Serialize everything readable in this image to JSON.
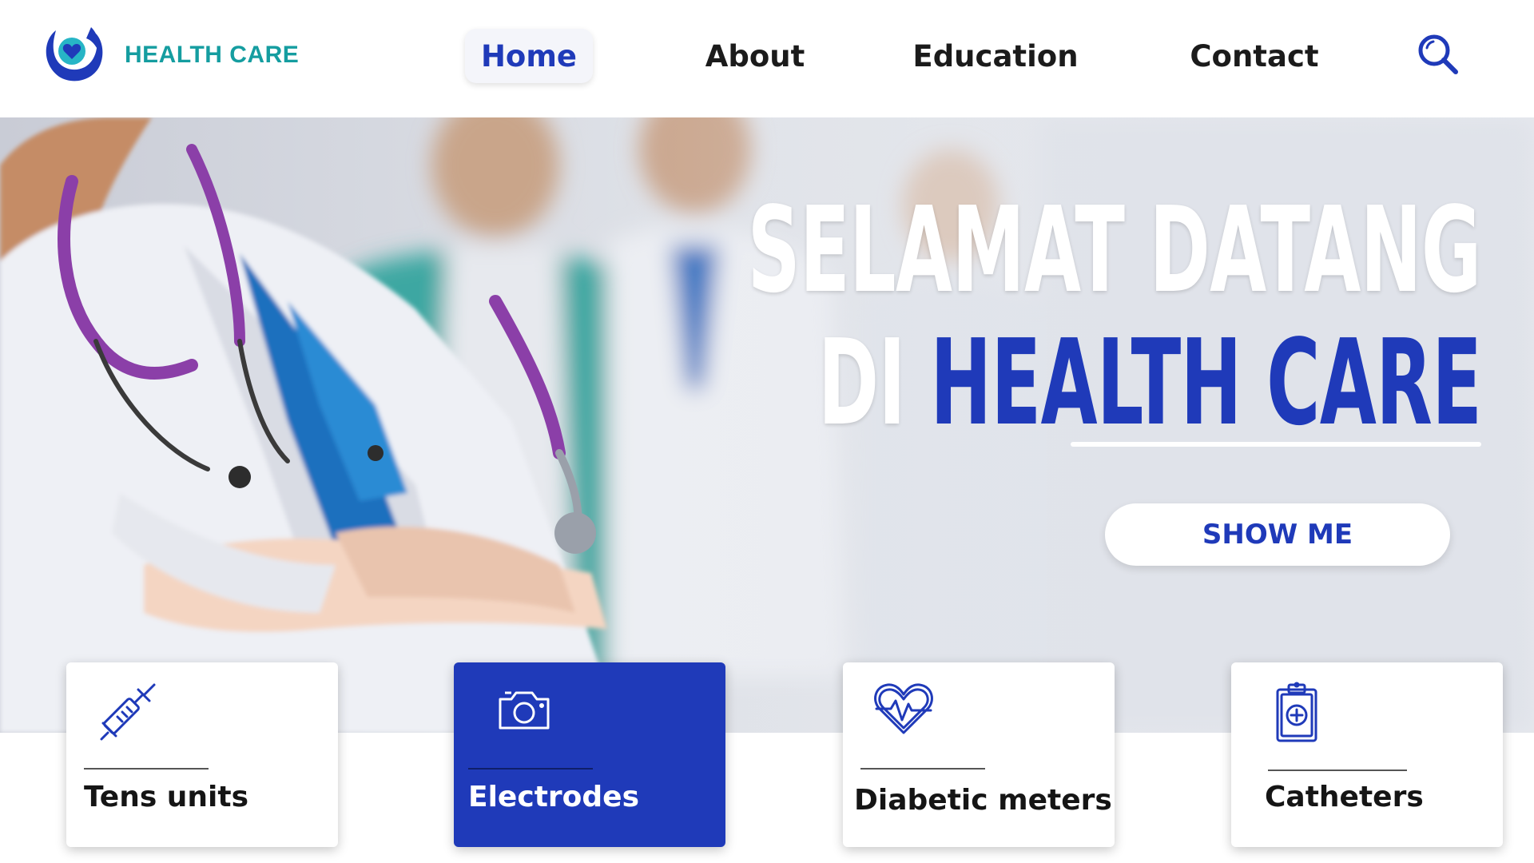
{
  "header": {
    "brand": "HEALTH CARE",
    "logo_icon": "heart-hands-logo",
    "nav": [
      {
        "label": "Home",
        "active": true
      },
      {
        "label": "About",
        "active": false
      },
      {
        "label": "Education",
        "active": false
      },
      {
        "label": "Contact",
        "active": false
      }
    ],
    "search_icon": "search-icon"
  },
  "hero": {
    "title_line1": "SELAMAT DATANG",
    "title_line2_prefix": "DI",
    "title_line2_highlight": "HEALTH CARE",
    "cta_label": "SHOW ME"
  },
  "cards": [
    {
      "label": "Tens units",
      "icon": "syringe-icon",
      "active": false
    },
    {
      "label": "Electrodes",
      "icon": "camera-icon",
      "active": true
    },
    {
      "label": "Diabetic meters",
      "icon": "heart-pulse-icon",
      "active": false
    },
    {
      "label": "Catheters",
      "icon": "clipboard-plus-icon",
      "active": false
    }
  ],
  "colors": {
    "accent_blue": "#1f3ab9",
    "brand_teal": "#159da0",
    "text_dark": "#151515",
    "white": "#ffffff"
  }
}
